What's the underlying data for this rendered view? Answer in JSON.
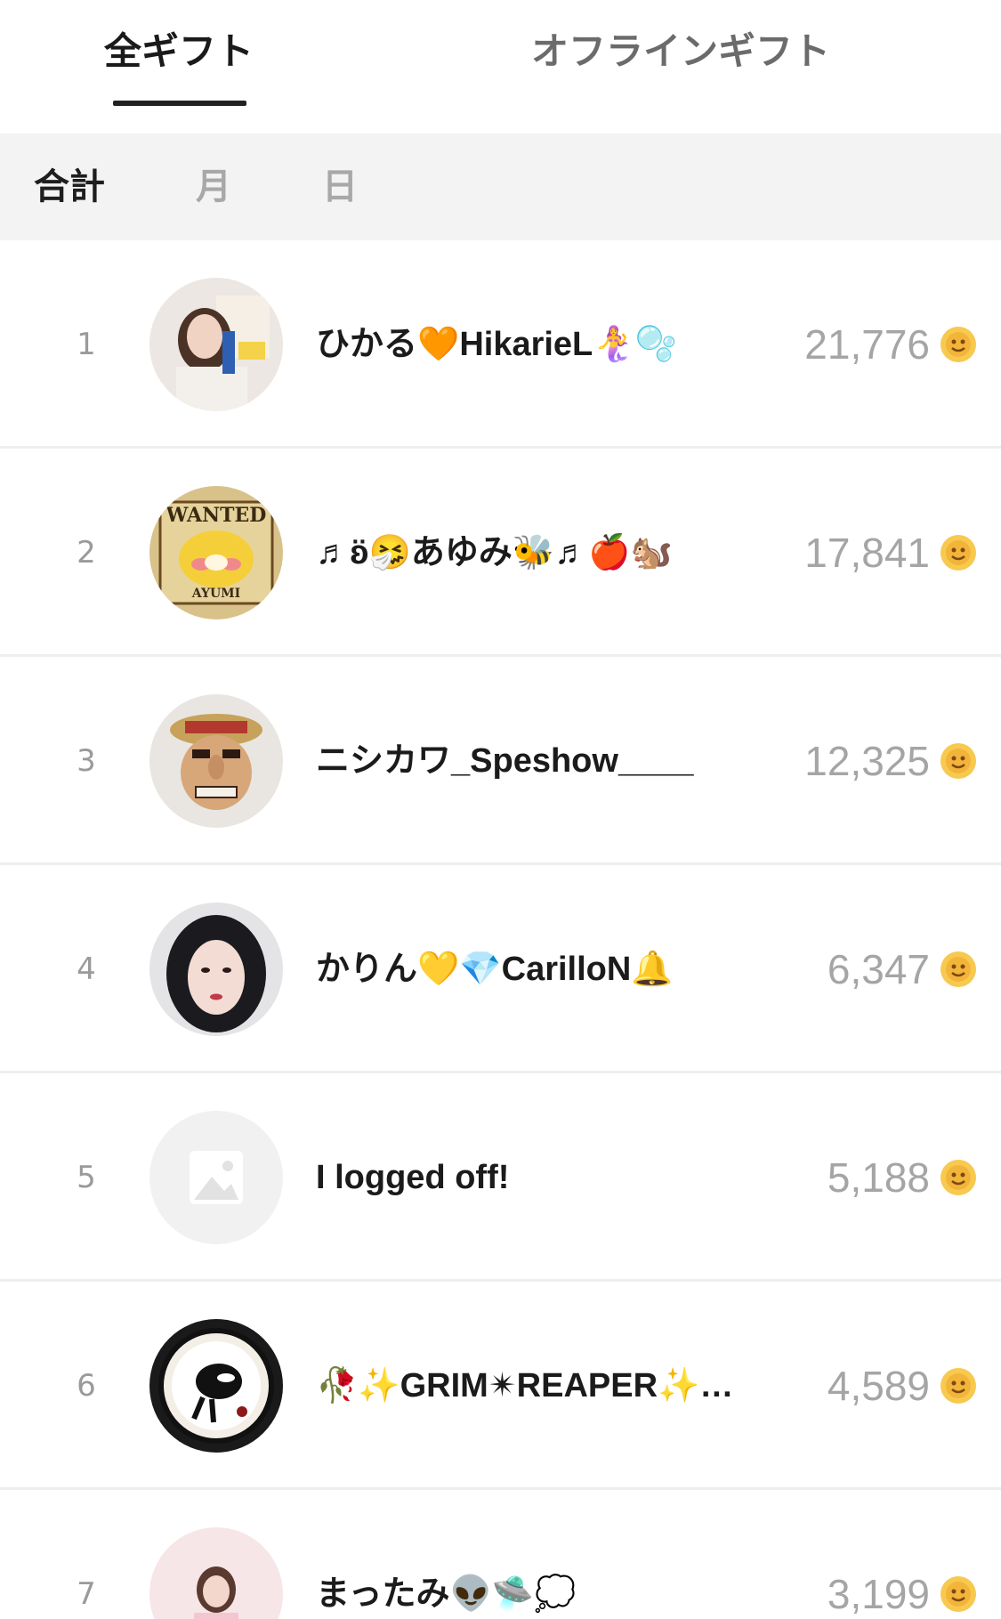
{
  "tabs": {
    "all_gifts": "全ギフト",
    "offline_gifts": "オフラインギフト"
  },
  "period": {
    "total": "合計",
    "month": "月",
    "day": "日"
  },
  "colors": {
    "active_text": "#1a1a1a",
    "inactive_text": "#a8a8a8",
    "coin": "#f6c24a",
    "count_text": "#a5a5a5"
  },
  "ranking": [
    {
      "rank": "1",
      "name": "ひかる🧡HikarieL🧜‍♀️🫧",
      "count": "21,776",
      "avatar": "user-photo"
    },
    {
      "rank": "2",
      "name": "♬ʚ̈🤧あゆみ🐝♬🍎🐿️",
      "count": "17,841",
      "avatar": "wanted-poster"
    },
    {
      "rank": "3",
      "name": "ニシカワ_Speshow____",
      "count": "12,325",
      "avatar": "figure-photo"
    },
    {
      "rank": "4",
      "name": "かりん💛💎CarilloN🔔",
      "count": "6,347",
      "avatar": "user-photo"
    },
    {
      "rank": "5",
      "name": "I logged off!",
      "count": "5,188",
      "avatar": "placeholder-image"
    },
    {
      "rank": "6",
      "name": "🥀✨GRIM✴︎REAPER✨…",
      "count": "4,589",
      "avatar": "reaper-badge"
    },
    {
      "rank": "7",
      "name": "まったみ👽🛸💭",
      "count": "3,199",
      "avatar": "user-photo"
    }
  ]
}
